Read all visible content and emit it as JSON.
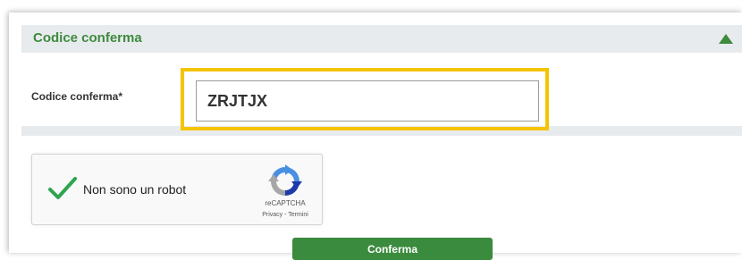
{
  "section": {
    "title": "Codice conferma"
  },
  "form": {
    "field_label": "Codice conferma*",
    "code_value": "ZRJTJX"
  },
  "captcha": {
    "label": "Non sono un robot",
    "brand": "reCAPTCHA",
    "privacy": "Privacy",
    "separator": " - ",
    "terms": "Termini",
    "checked": true
  },
  "actions": {
    "confirm_label": "Conferma"
  },
  "colors": {
    "accent_green": "#3d8b3d",
    "highlight_yellow": "#f5c400",
    "header_gray": "#e8ebee",
    "captcha_check_green": "#2ea44f"
  },
  "icons": {
    "collapse": "triangle-up-icon",
    "captcha_check": "checkmark-icon",
    "captcha_logo": "recaptcha-logo-icon"
  }
}
